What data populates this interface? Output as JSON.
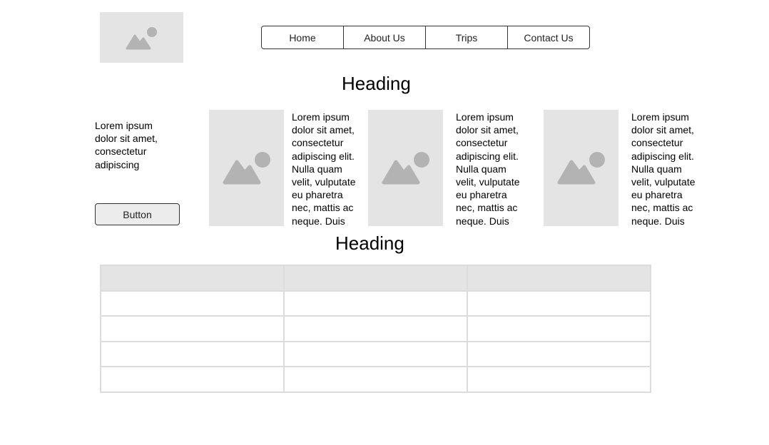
{
  "nav": {
    "items": [
      "Home",
      "About Us",
      "Trips",
      "Contact Us"
    ]
  },
  "section1": {
    "heading": "Heading",
    "intro": "Lorem ipsum dolor sit amet, consectetur adipiscing",
    "button_label": "Button",
    "cards": [
      {
        "text": "Lorem ipsum dolor sit amet, consectetur adipiscing elit. Nulla quam velit, vulputate eu pharetra nec, mattis ac neque. Duis"
      },
      {
        "text": "Lorem ipsum dolor sit amet, consectetur adipiscing elit. Nulla quam velit, vulputate eu pharetra nec, mattis ac neque. Duis"
      },
      {
        "text": "Lorem ipsum dolor sit amet, consectetur adipiscing elit. Nulla quam velit, vulputate eu pharetra nec, mattis ac neque. Duis"
      }
    ]
  },
  "section2": {
    "heading": "Heading",
    "table": {
      "columns": 3,
      "rows": 5
    }
  },
  "colors": {
    "placeholder_bg": "#e4e4e4",
    "placeholder_icon": "#b3b3b3",
    "border": "#333333",
    "table_border": "#dcdcdc"
  }
}
